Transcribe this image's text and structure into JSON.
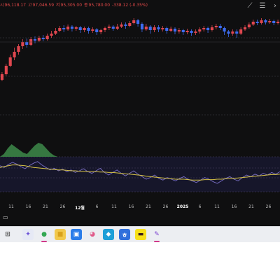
{
  "ohlc": {
    "open_label": "시",
    "open": "96,118.17",
    "high_label": "고",
    "high": "97,046.59",
    "low_label": "저",
    "low": "95,305.00",
    "close_label": "종",
    "close": "95,780.00",
    "change": "-338.12 (-0.35%)"
  },
  "toolbar": {
    "draw_icon": "pencil-line-icon",
    "settings_icon": "sliders-icon",
    "more_icon": "chevron-right-icon"
  },
  "colors": {
    "background": "#0f0f10",
    "up": "#e0474f",
    "down": "#3d6cf0",
    "rsi_line": "#7a6fc8",
    "signal_line": "#d6c246",
    "area_fill": "#3d8a4a"
  },
  "x_axis": {
    "labels": [
      "11",
      "16",
      "21",
      "26",
      "12월",
      "6",
      "11",
      "16",
      "21",
      "26",
      "2025",
      "6",
      "11",
      "16",
      "21",
      "26"
    ],
    "major": [
      "12월",
      "2025"
    ]
  },
  "chart_data": {
    "type": "candlestick",
    "ohlc_shown": {
      "open": 96118.17,
      "high": 97046.59,
      "low": 95305.0,
      "close": 95780.0,
      "change": -338.12,
      "change_pct": -0.35
    },
    "candles": [
      {
        "o": 0.12,
        "c": 0.2,
        "h": 0.23,
        "l": 0.1
      },
      {
        "o": 0.2,
        "c": 0.32,
        "h": 0.35,
        "l": 0.18
      },
      {
        "o": 0.32,
        "c": 0.44,
        "h": 0.48,
        "l": 0.3
      },
      {
        "o": 0.44,
        "c": 0.52,
        "h": 0.58,
        "l": 0.4
      },
      {
        "o": 0.52,
        "c": 0.6,
        "h": 0.63,
        "l": 0.48
      },
      {
        "o": 0.6,
        "c": 0.66,
        "h": 0.7,
        "l": 0.56
      },
      {
        "o": 0.66,
        "c": 0.62,
        "h": 0.71,
        "l": 0.58
      },
      {
        "o": 0.62,
        "c": 0.7,
        "h": 0.73,
        "l": 0.6
      },
      {
        "o": 0.7,
        "c": 0.68,
        "h": 0.74,
        "l": 0.64
      },
      {
        "o": 0.68,
        "c": 0.72,
        "h": 0.75,
        "l": 0.66
      },
      {
        "o": 0.72,
        "c": 0.7,
        "h": 0.76,
        "l": 0.67
      },
      {
        "o": 0.7,
        "c": 0.75,
        "h": 0.78,
        "l": 0.68
      },
      {
        "o": 0.75,
        "c": 0.78,
        "h": 0.82,
        "l": 0.72
      },
      {
        "o": 0.78,
        "c": 0.82,
        "h": 0.86,
        "l": 0.76
      },
      {
        "o": 0.82,
        "c": 0.86,
        "h": 0.89,
        "l": 0.8
      },
      {
        "o": 0.86,
        "c": 0.84,
        "h": 0.9,
        "l": 0.8
      },
      {
        "o": 0.84,
        "c": 0.88,
        "h": 0.91,
        "l": 0.82
      },
      {
        "o": 0.88,
        "c": 0.85,
        "h": 0.9,
        "l": 0.81
      },
      {
        "o": 0.85,
        "c": 0.87,
        "h": 0.89,
        "l": 0.82
      },
      {
        "o": 0.87,
        "c": 0.83,
        "h": 0.89,
        "l": 0.79
      },
      {
        "o": 0.83,
        "c": 0.86,
        "h": 0.88,
        "l": 0.8
      },
      {
        "o": 0.86,
        "c": 0.82,
        "h": 0.88,
        "l": 0.78
      },
      {
        "o": 0.82,
        "c": 0.84,
        "h": 0.87,
        "l": 0.79
      },
      {
        "o": 0.84,
        "c": 0.8,
        "h": 0.86,
        "l": 0.76
      },
      {
        "o": 0.8,
        "c": 0.83,
        "h": 0.85,
        "l": 0.77
      },
      {
        "o": 0.83,
        "c": 0.86,
        "h": 0.88,
        "l": 0.8
      },
      {
        "o": 0.86,
        "c": 0.88,
        "h": 0.91,
        "l": 0.83
      },
      {
        "o": 0.88,
        "c": 0.85,
        "h": 0.9,
        "l": 0.82
      },
      {
        "o": 0.85,
        "c": 0.88,
        "h": 0.92,
        "l": 0.83
      },
      {
        "o": 0.88,
        "c": 0.91,
        "h": 0.94,
        "l": 0.86
      },
      {
        "o": 0.91,
        "c": 0.89,
        "h": 0.94,
        "l": 0.85
      },
      {
        "o": 0.89,
        "c": 0.93,
        "h": 0.96,
        "l": 0.87
      },
      {
        "o": 0.93,
        "c": 0.97,
        "h": 1.0,
        "l": 0.91
      },
      {
        "o": 0.97,
        "c": 0.92,
        "h": 0.99,
        "l": 0.88
      },
      {
        "o": 0.92,
        "c": 0.84,
        "h": 0.94,
        "l": 0.8
      },
      {
        "o": 0.84,
        "c": 0.88,
        "h": 0.92,
        "l": 0.82
      },
      {
        "o": 0.88,
        "c": 0.83,
        "h": 0.9,
        "l": 0.78
      },
      {
        "o": 0.83,
        "c": 0.87,
        "h": 0.9,
        "l": 0.8
      },
      {
        "o": 0.87,
        "c": 0.84,
        "h": 0.9,
        "l": 0.8
      },
      {
        "o": 0.84,
        "c": 0.86,
        "h": 0.89,
        "l": 0.81
      },
      {
        "o": 0.86,
        "c": 0.82,
        "h": 0.88,
        "l": 0.78
      },
      {
        "o": 0.82,
        "c": 0.85,
        "h": 0.88,
        "l": 0.8
      },
      {
        "o": 0.85,
        "c": 0.81,
        "h": 0.87,
        "l": 0.77
      },
      {
        "o": 0.81,
        "c": 0.83,
        "h": 0.86,
        "l": 0.78
      },
      {
        "o": 0.83,
        "c": 0.8,
        "h": 0.85,
        "l": 0.76
      },
      {
        "o": 0.8,
        "c": 0.82,
        "h": 0.85,
        "l": 0.77
      },
      {
        "o": 0.82,
        "c": 0.79,
        "h": 0.84,
        "l": 0.75
      },
      {
        "o": 0.79,
        "c": 0.81,
        "h": 0.84,
        "l": 0.76
      },
      {
        "o": 0.81,
        "c": 0.84,
        "h": 0.87,
        "l": 0.78
      },
      {
        "o": 0.84,
        "c": 0.86,
        "h": 0.89,
        "l": 0.81
      },
      {
        "o": 0.86,
        "c": 0.83,
        "h": 0.88,
        "l": 0.79
      },
      {
        "o": 0.83,
        "c": 0.87,
        "h": 0.9,
        "l": 0.81
      },
      {
        "o": 0.87,
        "c": 0.89,
        "h": 0.92,
        "l": 0.84
      },
      {
        "o": 0.89,
        "c": 0.86,
        "h": 0.92,
        "l": 0.83
      },
      {
        "o": 0.86,
        "c": 0.81,
        "h": 0.88,
        "l": 0.76
      },
      {
        "o": 0.81,
        "c": 0.78,
        "h": 0.83,
        "l": 0.73
      },
      {
        "o": 0.78,
        "c": 0.81,
        "h": 0.84,
        "l": 0.75
      },
      {
        "o": 0.81,
        "c": 0.78,
        "h": 0.84,
        "l": 0.72
      },
      {
        "o": 0.78,
        "c": 0.84,
        "h": 0.87,
        "l": 0.76
      },
      {
        "o": 0.84,
        "c": 0.87,
        "h": 0.9,
        "l": 0.82
      },
      {
        "o": 0.87,
        "c": 0.91,
        "h": 0.94,
        "l": 0.85
      },
      {
        "o": 0.91,
        "c": 0.95,
        "h": 0.98,
        "l": 0.89
      },
      {
        "o": 0.95,
        "c": 0.93,
        "h": 0.98,
        "l": 0.9
      },
      {
        "o": 0.93,
        "c": 0.97,
        "h": 1.0,
        "l": 0.91
      },
      {
        "o": 0.97,
        "c": 0.94,
        "h": 0.99,
        "l": 0.91
      },
      {
        "o": 0.94,
        "c": 0.96,
        "h": 0.99,
        "l": 0.92
      },
      {
        "o": 0.96,
        "c": 0.93,
        "h": 0.98,
        "l": 0.9
      },
      {
        "o": 0.93,
        "c": 0.95,
        "h": 0.98,
        "l": 0.91
      }
    ],
    "indicator": {
      "rsi": [
        0.62,
        0.58,
        0.65,
        0.7,
        0.66,
        0.6,
        0.55,
        0.62,
        0.68,
        0.72,
        0.64,
        0.58,
        0.52,
        0.56,
        0.5,
        0.54,
        0.48,
        0.52,
        0.46,
        0.5,
        0.55,
        0.48,
        0.44,
        0.5,
        0.56,
        0.46,
        0.4,
        0.46,
        0.52,
        0.44,
        0.38,
        0.44,
        0.5,
        0.42,
        0.36,
        0.3,
        0.34,
        0.4,
        0.32,
        0.28,
        0.34,
        0.3,
        0.26,
        0.32,
        0.36,
        0.3,
        0.26,
        0.22,
        0.28,
        0.34,
        0.3,
        0.24,
        0.2,
        0.26,
        0.32,
        0.36,
        0.3,
        0.26,
        0.34,
        0.4,
        0.36,
        0.42,
        0.38,
        0.44,
        0.4,
        0.46,
        0.42,
        0.48
      ],
      "signal": [
        0.58,
        0.6,
        0.62,
        0.64,
        0.64,
        0.63,
        0.62,
        0.6,
        0.58,
        0.57,
        0.56,
        0.55,
        0.54,
        0.53,
        0.52,
        0.52,
        0.51,
        0.5,
        0.5,
        0.49,
        0.49,
        0.48,
        0.48,
        0.48,
        0.47,
        0.47,
        0.46,
        0.46,
        0.45,
        0.44,
        0.43,
        0.42,
        0.41,
        0.4,
        0.39,
        0.37,
        0.36,
        0.35,
        0.34,
        0.33,
        0.32,
        0.31,
        0.3,
        0.3,
        0.3,
        0.29,
        0.28,
        0.28,
        0.28,
        0.29,
        0.29,
        0.29,
        0.3,
        0.3,
        0.31,
        0.32,
        0.32,
        0.33,
        0.34,
        0.35,
        0.36,
        0.37,
        0.38,
        0.39,
        0.4,
        0.41,
        0.41,
        0.42
      ],
      "area": [
        0.0,
        0.2,
        0.6,
        0.9,
        0.7,
        0.5,
        0.3,
        0.2,
        0.5,
        0.8,
        1.0,
        0.9,
        0.6,
        0.3,
        0.1,
        0.0
      ]
    }
  },
  "taskbar": {
    "items": [
      {
        "name": "copilot-icon",
        "glyph": "✦",
        "bg": "#e6e9f5",
        "fg": "#6a4fd6"
      },
      {
        "name": "chrome-icon",
        "glyph": "●",
        "bg": "#eceef2",
        "fg": "#34a853"
      },
      {
        "name": "file-explorer-icon",
        "glyph": "■",
        "bg": "#f2c94c",
        "fg": "#d9a21b"
      },
      {
        "name": "photos-icon",
        "glyph": "▣",
        "bg": "#2b7de9",
        "fg": "#ffffff"
      },
      {
        "name": "paint-icon",
        "glyph": "◕",
        "bg": "#eceef2",
        "fg": "#e05a8a"
      },
      {
        "name": "store-icon",
        "glyph": "◆",
        "bg": "#1d9fd8",
        "fg": "#ffffff"
      },
      {
        "name": "hangul-icon",
        "glyph": "ㅎ",
        "bg": "#2f6fdc",
        "fg": "#ffffff"
      },
      {
        "name": "kakaotalk-icon",
        "glyph": "▬",
        "bg": "#f7e01b",
        "fg": "#3c1e1e"
      },
      {
        "name": "notes-icon",
        "glyph": "✎",
        "bg": "#eceef2",
        "fg": "#7a3fd0"
      }
    ],
    "widget_icon": "widgets-icon"
  }
}
